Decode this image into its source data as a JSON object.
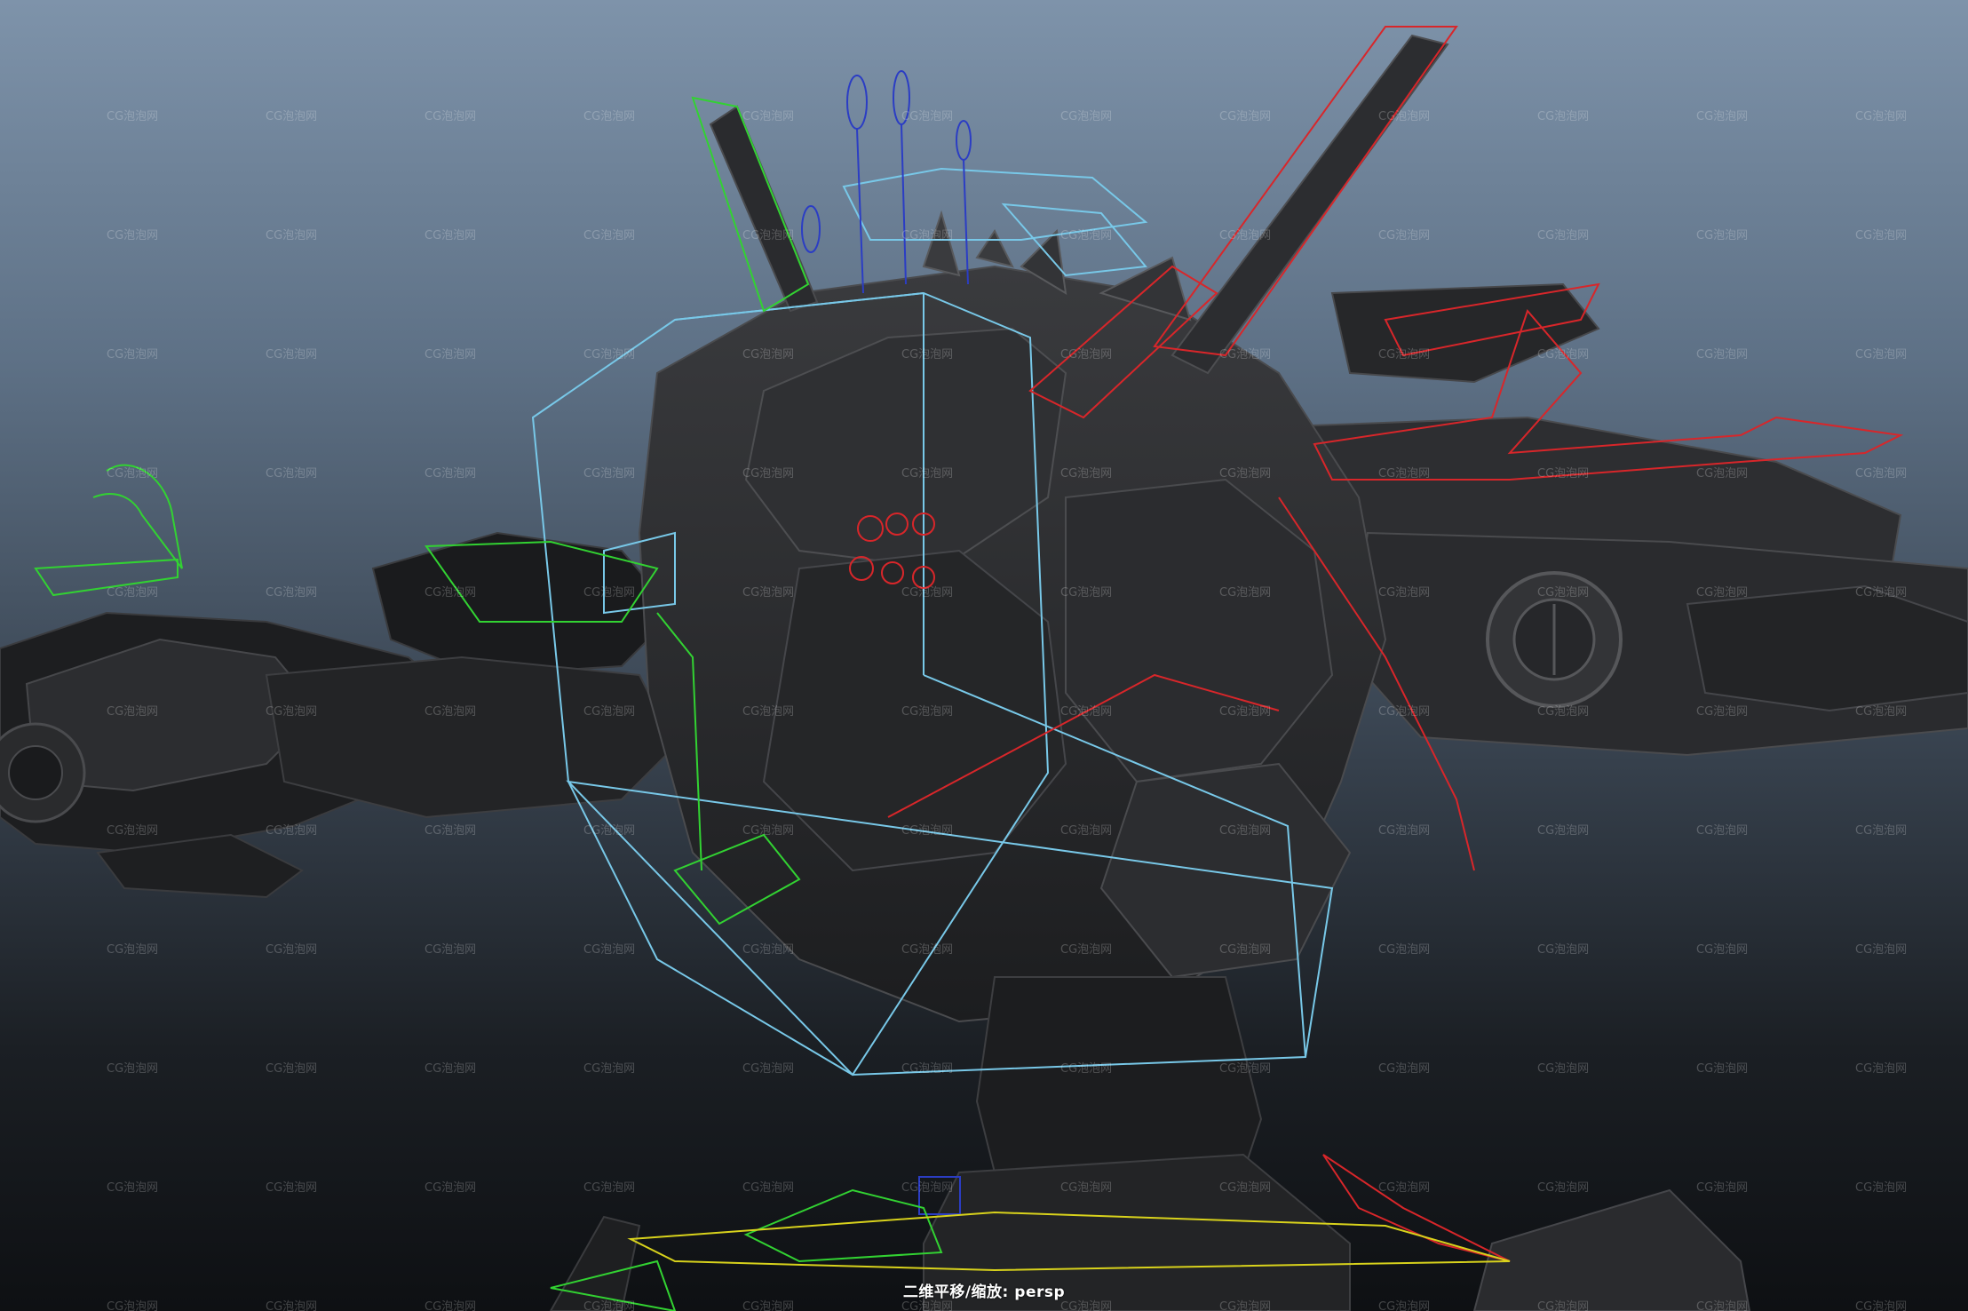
{
  "viewport": {
    "camera_name": "persp",
    "hud_label": "二维平移/缩放: persp",
    "watermark_text": "CG泡泡网"
  },
  "colors": {
    "background_top": "#7e93aa",
    "background_bottom": "#0e1013",
    "mesh": "#2b2c2e",
    "control_cyan": "#78c8e8",
    "control_red": "#d8262a",
    "control_green": "#32d232",
    "control_blue": "#2b3dc4",
    "control_yellow": "#d8d21c"
  }
}
